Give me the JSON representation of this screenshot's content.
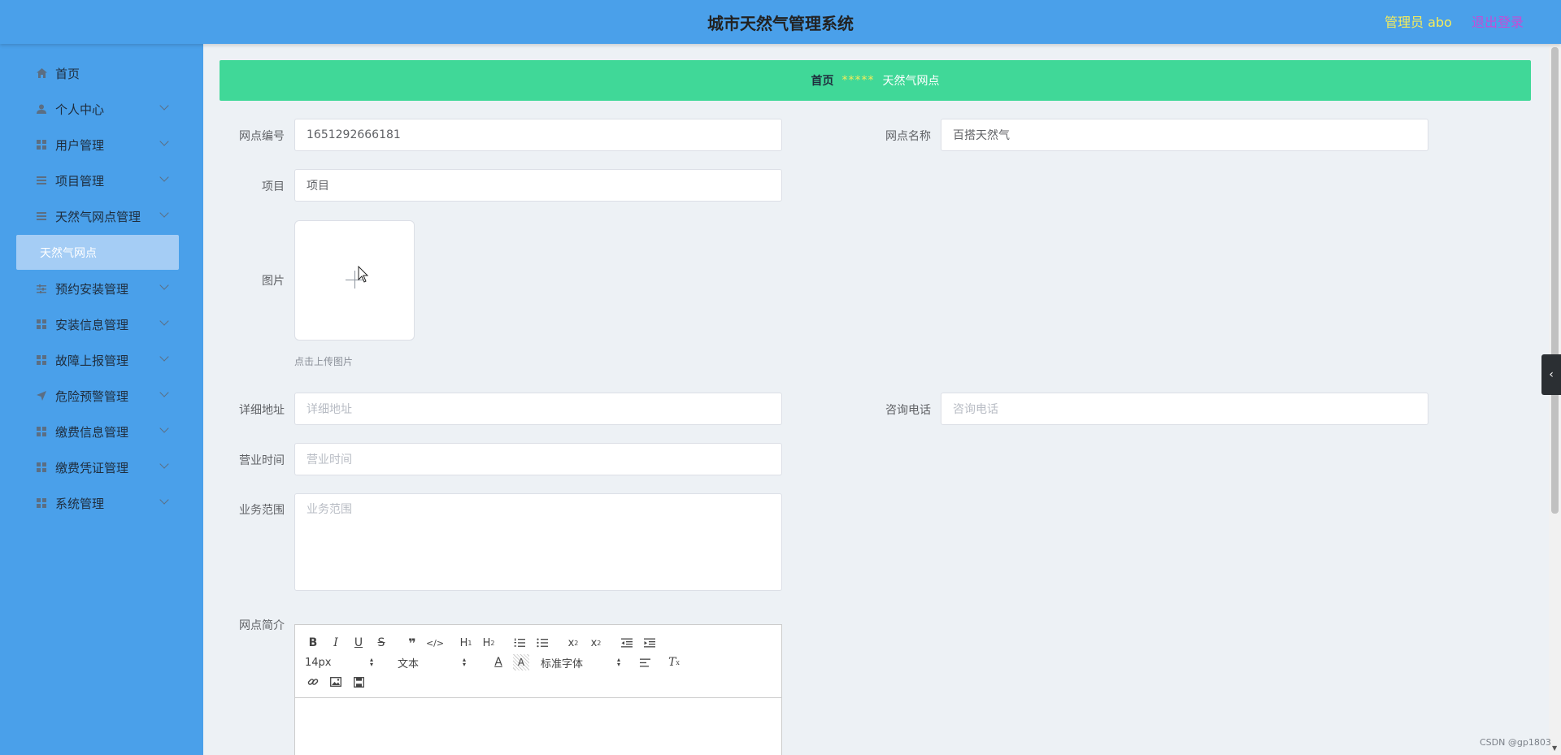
{
  "header": {
    "title": "城市天然气管理系统",
    "user_label": "管理员 abo",
    "logout_label": "退出登录"
  },
  "sidebar": {
    "items": [
      {
        "label": "首页",
        "icon": "home-icon"
      },
      {
        "label": "个人中心",
        "icon": "user-icon"
      },
      {
        "label": "用户管理",
        "icon": "grid-icon"
      },
      {
        "label": "项目管理",
        "icon": "list-icon"
      },
      {
        "label": "天然气网点管理",
        "icon": "list-icon"
      },
      {
        "label": "预约安装管理",
        "icon": "sliders-icon"
      },
      {
        "label": "安装信息管理",
        "icon": "grid-icon"
      },
      {
        "label": "故障上报管理",
        "icon": "grid-icon"
      },
      {
        "label": "危险预警管理",
        "icon": "send-icon"
      },
      {
        "label": "缴费信息管理",
        "icon": "grid-icon"
      },
      {
        "label": "缴费凭证管理",
        "icon": "grid-icon"
      },
      {
        "label": "系统管理",
        "icon": "grid-icon"
      }
    ],
    "active_sub": "天然气网点"
  },
  "breadcrumb": {
    "home": "首页",
    "separator": "*****",
    "current": "天然气网点"
  },
  "form": {
    "code_label": "网点编号",
    "code_value": "1651292666181",
    "name_label": "网点名称",
    "name_value": "百搭天然气",
    "project_label": "项目",
    "project_value": "项目",
    "image_label": "图片",
    "upload_tip": "点击上传图片",
    "address_label": "详细地址",
    "address_placeholder": "详细地址",
    "phone_label": "咨询电话",
    "phone_placeholder": "咨询电话",
    "hours_label": "营业时间",
    "hours_placeholder": "营业时间",
    "scope_label": "业务范围",
    "scope_placeholder": "业务范围",
    "intro_label": "网点简介"
  },
  "editor": {
    "font_size": "14px",
    "header_select": "文本",
    "font_family": "标准字体"
  },
  "watermark": "CSDN @gp1803"
}
